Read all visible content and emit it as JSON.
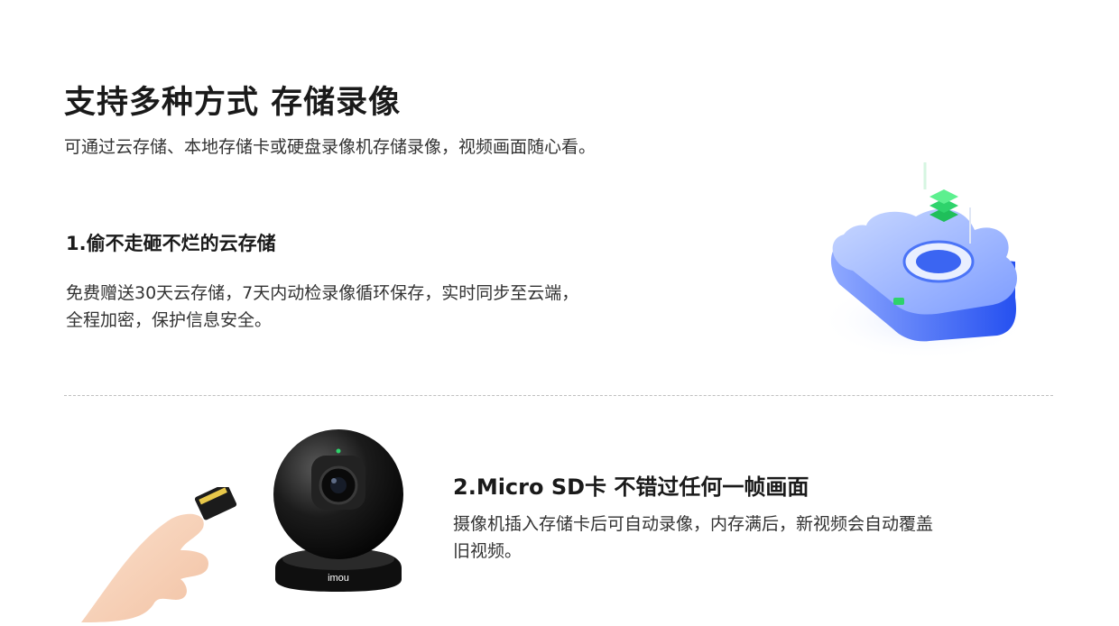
{
  "header": {
    "title": "支持多种方式 存储录像",
    "subtitle": "可通过云存储、本地存储卡或硬盘录像机存储录像，视频画面随心看。"
  },
  "section_cloud": {
    "title": "1.偷不走砸不烂的云存储",
    "description_line1": "免费赠送30天云存储，7天内动检录像循环保存，实时同步至云端，",
    "description_line2": "全程加密，保护信息安全。"
  },
  "section_sd": {
    "title": "2.Micro SD卡 不错过任何一帧画面",
    "description_line1": "摄像机插入存储卡后可自动录像，内存满后，新视频会自动覆盖",
    "description_line2": "旧视频。"
  },
  "camera": {
    "brand": "imou"
  },
  "colors": {
    "cloud_blue": "#3b6cf6",
    "cloud_light": "#a9c0ff",
    "accent_green": "#2ed36b",
    "camera_black": "#111111"
  }
}
